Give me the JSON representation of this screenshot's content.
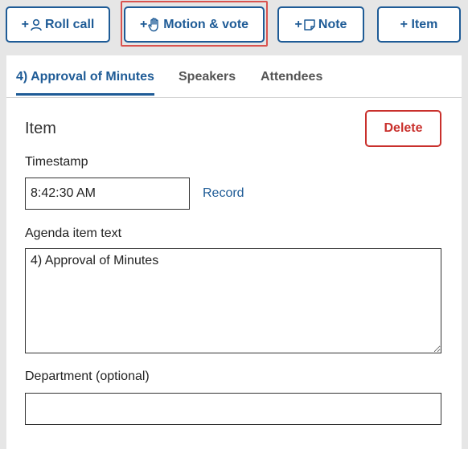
{
  "toolbar": {
    "roll_call_label": "Roll call",
    "motion_vote_label": "Motion & vote",
    "note_label": "Note",
    "item_label": "+ Item",
    "plus": "+"
  },
  "tabs": [
    {
      "label": "4) Approval of Minutes",
      "active": true
    },
    {
      "label": "Speakers",
      "active": false
    },
    {
      "label": "Attendees",
      "active": false
    }
  ],
  "item_form": {
    "title": "Item",
    "delete_label": "Delete",
    "timestamp_label": "Timestamp",
    "timestamp_value": "8:42:30 AM",
    "record_label": "Record",
    "agenda_text_label": "Agenda item text",
    "agenda_text_value": "4) Approval of Minutes",
    "department_label": "Department (optional)",
    "department_value": ""
  },
  "colors": {
    "primary": "#1e5b96",
    "danger": "#c9302c",
    "focus_outline": "#d9534f",
    "background": "#e6e6e6"
  }
}
